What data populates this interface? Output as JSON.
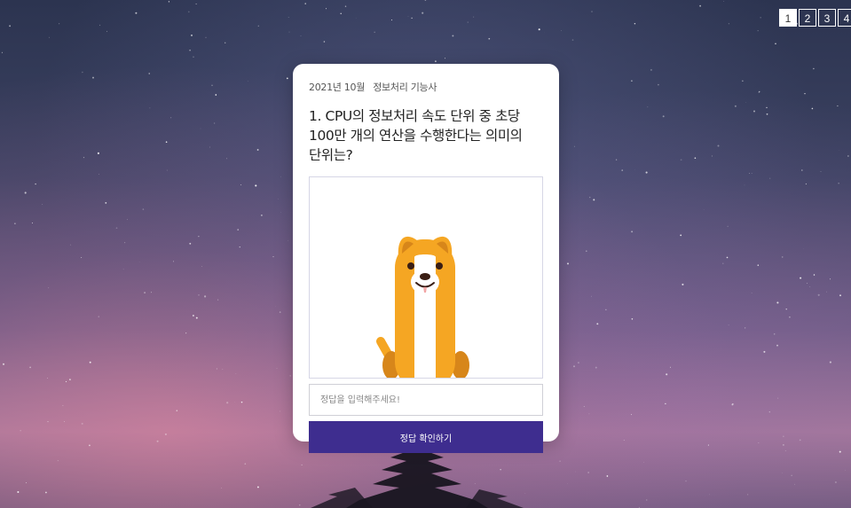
{
  "pagination": {
    "pages": [
      "1",
      "2",
      "3",
      "4"
    ],
    "active_index": 0
  },
  "card": {
    "exam_date": "2021년 10월",
    "exam_name": "정보처리 기능사",
    "question": "1. CPU의 정보처리 속도 단위 중 초당 100만 개의 연산을 수행한다는 의미의 단위는?",
    "image_description_icon": "dog-illustration-icon",
    "answer_placeholder": "정답을 입력해주세요!",
    "answer_value": "",
    "submit_label": "정답 확인하기"
  },
  "colors": {
    "button_bg": "#3e2d8f",
    "dog_orange": "#f5a623",
    "dog_dark_orange": "#d7861a",
    "card_bg": "#ffffff"
  }
}
